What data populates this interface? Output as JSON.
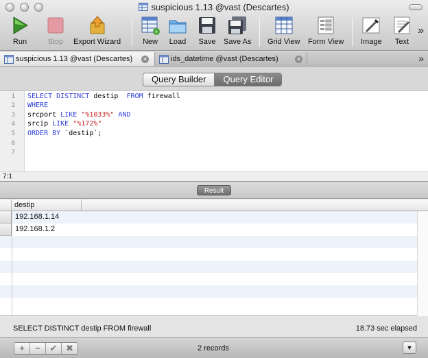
{
  "window": {
    "title": "suspicious 1.13 @vast (Descartes)"
  },
  "toolbar": {
    "items": [
      {
        "label": "Run",
        "icon": "run-icon"
      },
      {
        "label": "Stop",
        "icon": "stop-icon",
        "disabled": true
      },
      {
        "label": "Export Wizard",
        "icon": "export-wizard-icon"
      },
      {
        "label": "New",
        "icon": "new-icon"
      },
      {
        "label": "Load",
        "icon": "load-icon"
      },
      {
        "label": "Save",
        "icon": "save-icon"
      },
      {
        "label": "Save As",
        "icon": "save-as-icon"
      },
      {
        "label": "Grid View",
        "icon": "grid-view-icon"
      },
      {
        "label": "Form View",
        "icon": "form-view-icon"
      },
      {
        "label": "Image",
        "icon": "image-icon"
      },
      {
        "label": "Text",
        "icon": "text-icon"
      }
    ],
    "overflow": "»"
  },
  "tabs": [
    {
      "label": "suspicious 1.13 @vast (Descartes)",
      "active": true
    },
    {
      "label": "ids_datetime @vast (Descartes)",
      "active": false
    }
  ],
  "tabs_overflow": "»",
  "segmented": {
    "left": "Query Builder",
    "right": "Query Editor",
    "selected": "Query Editor"
  },
  "editor": {
    "line_numbers": [
      "1",
      "2",
      "3",
      "4",
      "5",
      "6",
      "7"
    ],
    "cursor_position": "7:1"
  },
  "result": {
    "label": "Result",
    "column": "destip",
    "rows": [
      "192.168.1.14",
      "192.168.1.2"
    ]
  },
  "status": {
    "query": "SELECT DISTINCT destip  FROM firewall",
    "elapsed": "18.73 sec elapsed"
  },
  "bottom": {
    "add": "+",
    "remove": "−",
    "apply": "✔",
    "discard": "✖",
    "records": "2 records"
  },
  "colors": {
    "keyword": "#2f3fd8",
    "string": "#c81f1f",
    "grid_stripe": "#edf3fb"
  }
}
